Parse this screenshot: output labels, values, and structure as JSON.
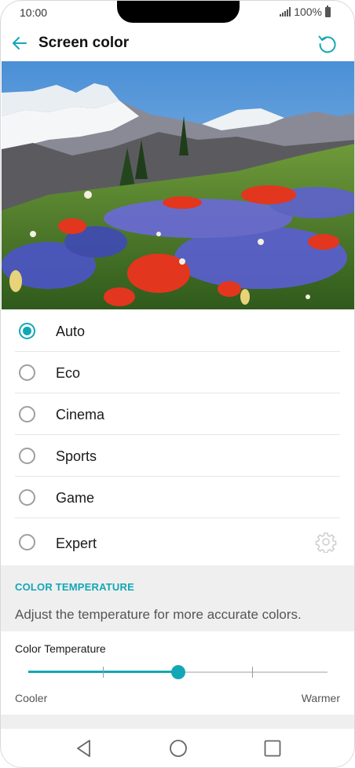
{
  "status_bar": {
    "time": "10:00",
    "battery": "100%"
  },
  "app_bar": {
    "title": "Screen color",
    "back_icon": "arrow-left-icon",
    "reset_icon": "reset-icon"
  },
  "colors": {
    "accent": "#12a7b5",
    "section_bg": "#efefef"
  },
  "options": [
    {
      "label": "Auto",
      "selected": true
    },
    {
      "label": "Eco",
      "selected": false
    },
    {
      "label": "Cinema",
      "selected": false
    },
    {
      "label": "Sports",
      "selected": false
    },
    {
      "label": "Game",
      "selected": false
    },
    {
      "label": "Expert",
      "selected": false,
      "icon": "gear-icon"
    }
  ],
  "color_temperature": {
    "heading": "COLOR TEMPERATURE",
    "description": "Adjust the temperature for more accurate colors.",
    "slider_label": "Color Temperature",
    "min_label": "Cooler",
    "max_label": "Warmer",
    "value_fraction": 0.5
  },
  "nav_bar": {
    "back": "triangle-back-icon",
    "home": "circle-home-icon",
    "recents": "square-recents-icon"
  }
}
